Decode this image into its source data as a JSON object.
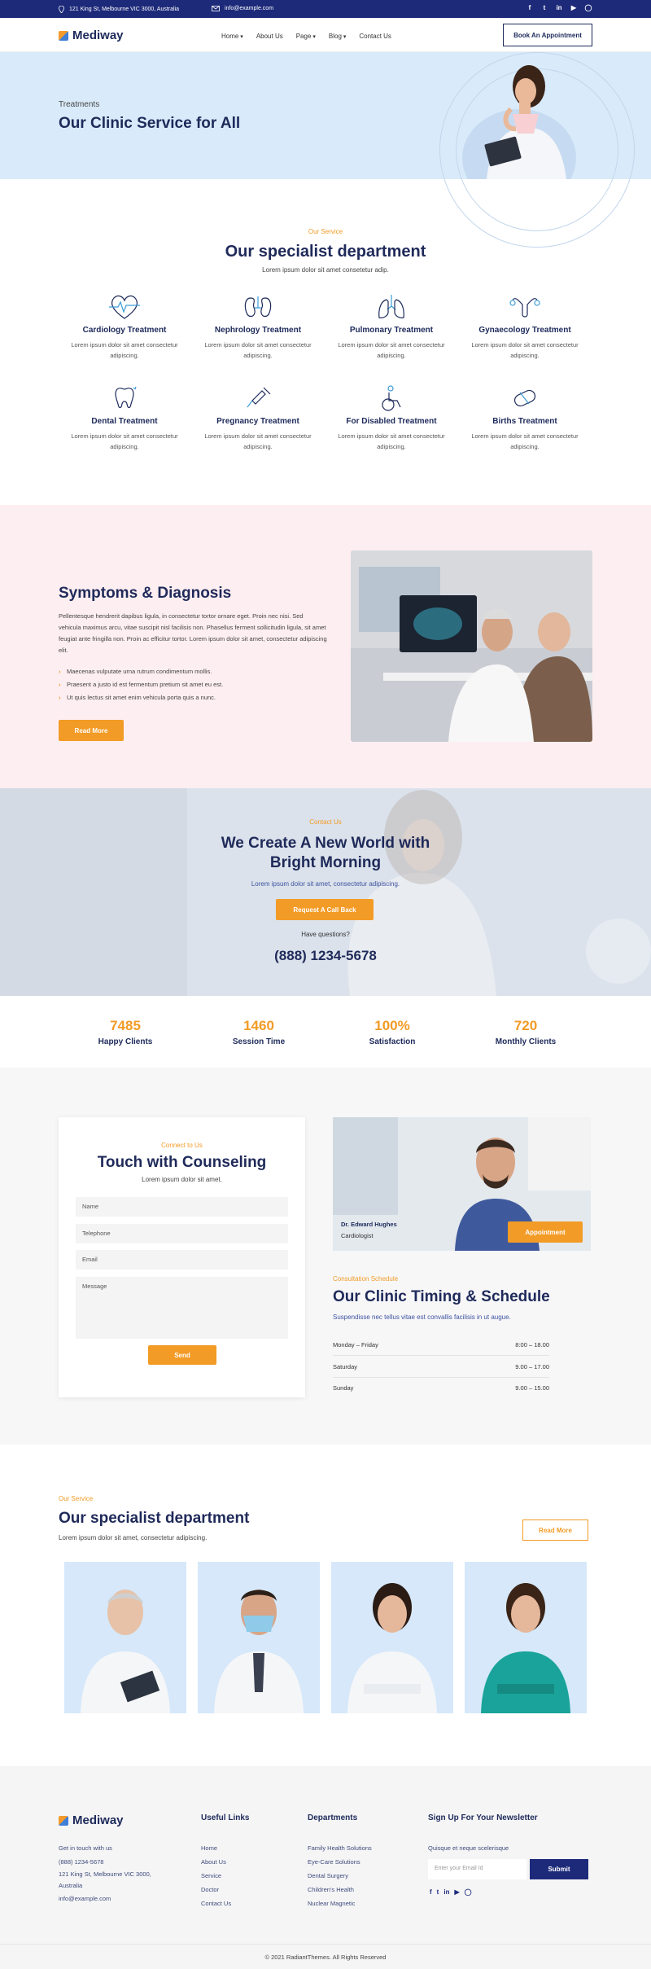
{
  "topbar": {
    "address": "121 King St, Melbourne VIC 3000, Australia",
    "email": "info@example.com",
    "social": [
      "facebook-icon",
      "twitter-icon",
      "linkedin-icon",
      "youtube-icon",
      "instagram-icon"
    ]
  },
  "nav": {
    "logo": "Mediway",
    "menu": [
      "Home",
      "About Us",
      "Page",
      "Blog",
      "Contact Us"
    ],
    "cta": "Book An Appointment"
  },
  "hero": {
    "crumb": "Treatments",
    "title": "Our Clinic Service for All"
  },
  "services": {
    "eyebrow": "Our Service",
    "title": "Our specialist department",
    "subtitle": "Lorem ipsum dolor sit amet consetetur adip.",
    "items": [
      {
        "title": "Cardiology Treatment",
        "desc": "Lorem ipsum dolor sit amet consectetur adipiscing.",
        "icon": "heart-icon"
      },
      {
        "title": "Nephrology Treatment",
        "desc": "Lorem ipsum dolor sit amet consectetur adipiscing.",
        "icon": "kidney-icon"
      },
      {
        "title": "Pulmonary Treatment",
        "desc": "Lorem ipsum dolor sit amet consectetur adipiscing.",
        "icon": "lungs-icon"
      },
      {
        "title": "Gynaecology Treatment",
        "desc": "Lorem ipsum dolor sit amet consectetur adipiscing.",
        "icon": "uterus-icon"
      },
      {
        "title": "Dental Treatment",
        "desc": "Lorem ipsum dolor sit amet consectetur adipiscing.",
        "icon": "tooth-icon"
      },
      {
        "title": "Pregnancy Treatment",
        "desc": "Lorem ipsum dolor sit amet consectetur adipiscing.",
        "icon": "syringe-icon"
      },
      {
        "title": "For Disabled Treatment",
        "desc": "Lorem ipsum dolor sit amet consectetur adipiscing.",
        "icon": "wheelchair-icon"
      },
      {
        "title": "Births Treatment",
        "desc": "Lorem ipsum dolor sit amet consectetur adipiscing.",
        "icon": "pill-icon"
      }
    ]
  },
  "symptoms": {
    "title": "Symptoms & Diagnosis",
    "body": "Pellentesque hendrerit dapibus ligula, in consectetur tortor ornare eget. Proin nec nisi. Sed vehicula maximus arcu, vitae suscipit nisl facilisis non. Phasellus ferment sollicitudin ligula, sit amet feugiat ante fringilla non. Proin ac efficitur tortor. Lorem ipsum dolor sit amet, consectetur adipiscing elit.",
    "bullets": [
      "Maecenas vulputate urna rutrum condimentum mollis.",
      "Praesent a justo id est fermentum pretium sit amet eu est.",
      "Ut quis lectus sit amet enim vehicula porta quis a nunc."
    ],
    "button": "Read More"
  },
  "cta": {
    "eyebrow": "Contact Us",
    "title": "We Create A New World with Bright Morning",
    "subtitle": "Lorem ipsum dolor sit amet, consectetur adipiscing.",
    "button": "Request A Call Back",
    "question": "Have questions?",
    "phone": "(888) 1234-5678"
  },
  "stats": [
    {
      "value": "7485",
      "label": "Happy Clients"
    },
    {
      "value": "1460",
      "label": "Session Time"
    },
    {
      "value": "100%",
      "label": "Satisfaction"
    },
    {
      "value": "720",
      "label": "Monthly Clients"
    }
  ],
  "counsel": {
    "eyebrow": "Connect to Us",
    "title": "Touch with Counseling",
    "subtitle": "Lorem ipsum dolor sit amet.",
    "fields": {
      "name": "Name",
      "telephone": "Telephone",
      "email": "Email",
      "message": "Message"
    },
    "button": "Send",
    "doctor": {
      "name": "Dr. Edward Hughes",
      "role": "Cardiologist",
      "button": "Appointment"
    }
  },
  "schedule": {
    "eyebrow": "Consultation Schedule",
    "title": "Our Clinic Timing & Schedule",
    "subtitle": "Suspendisse nec tellus vitae est convallis facilisis in ut augue.",
    "rows": [
      {
        "day": "Monday – Friday",
        "time": "8:00 – 18.00"
      },
      {
        "day": "Saturday",
        "time": "9.00 – 17.00"
      },
      {
        "day": "Sunday",
        "time": "9.00 – 15.00"
      }
    ]
  },
  "team": {
    "eyebrow": "Our Service",
    "title": "Our specialist department",
    "subtitle": "Lorem ipsum dolor sit amet, consectetur adipiscing.",
    "button": "Read More"
  },
  "footer": {
    "logo": "Mediway",
    "contact": {
      "intro": "Get in touch with us",
      "phone": "(888) 1234-5678",
      "address": "121 King St, Melbourne VIC 3000, Australia",
      "email": "info@example.com"
    },
    "useful": {
      "title": "Useful Links",
      "links": [
        "Home",
        "About Us",
        "Service",
        "Doctor",
        "Contact Us"
      ]
    },
    "departments": {
      "title": "Departments",
      "links": [
        "Family Health Solutions",
        "Eye-Care Solutions",
        "Dental Surgery",
        "Children's Health",
        "Nuclear Magnetic"
      ]
    },
    "newsletter": {
      "title": "Sign Up For Your Newsletter",
      "text": "Quisque et neque scelerisque",
      "placeholder": "Enter your Email Id",
      "button": "Submit"
    },
    "copyright": "© 2021 RadiantThemes. All Rights Reserved"
  },
  "colors": {
    "navy": "#1d2a7a",
    "orange": "#f29b26",
    "hero_bg": "#d9ebfa",
    "pink_bg": "#fdeef1"
  }
}
